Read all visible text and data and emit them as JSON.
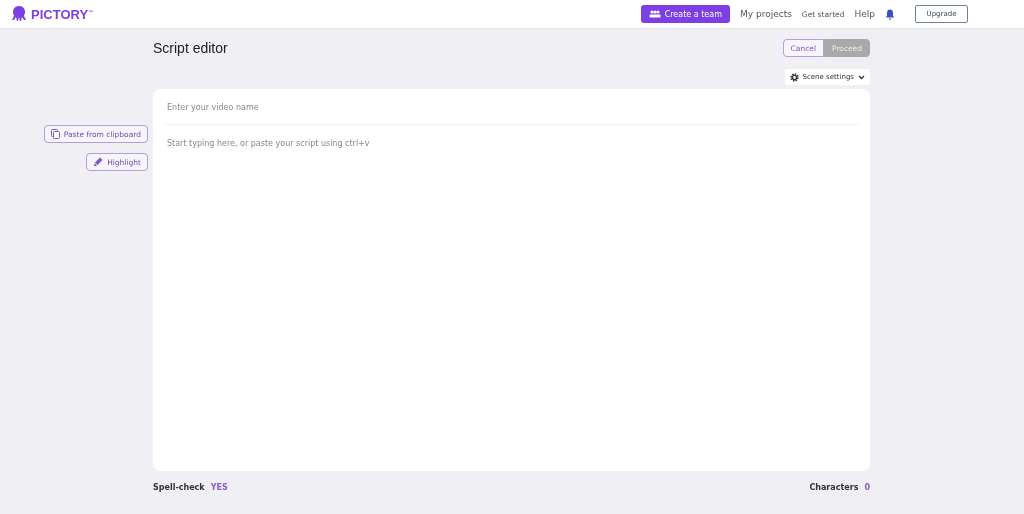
{
  "header": {
    "logo": "PICTORY",
    "logo_mark": "™",
    "nav": [
      {
        "label": "Create a team",
        "kind": "primary"
      },
      {
        "label": "My projects",
        "kind": "link"
      },
      {
        "label": "Get started",
        "kind": "small"
      },
      {
        "label": "Help",
        "kind": "link"
      }
    ],
    "upgrade": "Upgrade"
  },
  "title": "Script editor",
  "actions": [
    {
      "label": "Cancel",
      "disabled": false
    },
    {
      "label": "Proceed",
      "disabled": true
    }
  ],
  "scene_settings": "Scene settings",
  "side_buttons": [
    {
      "label": "Paste from clipboard",
      "kind": "paste"
    },
    {
      "label": "Highlight",
      "kind": "highlight"
    }
  ],
  "editor": {
    "name_placeholder": "Enter your video name",
    "script_placeholder": "Start typing here, or paste your script using ctrl+v"
  },
  "footer": {
    "spell_label": "Spell-check",
    "spell_value": "YES",
    "chars_label": "Characters",
    "chars_value": "0"
  }
}
